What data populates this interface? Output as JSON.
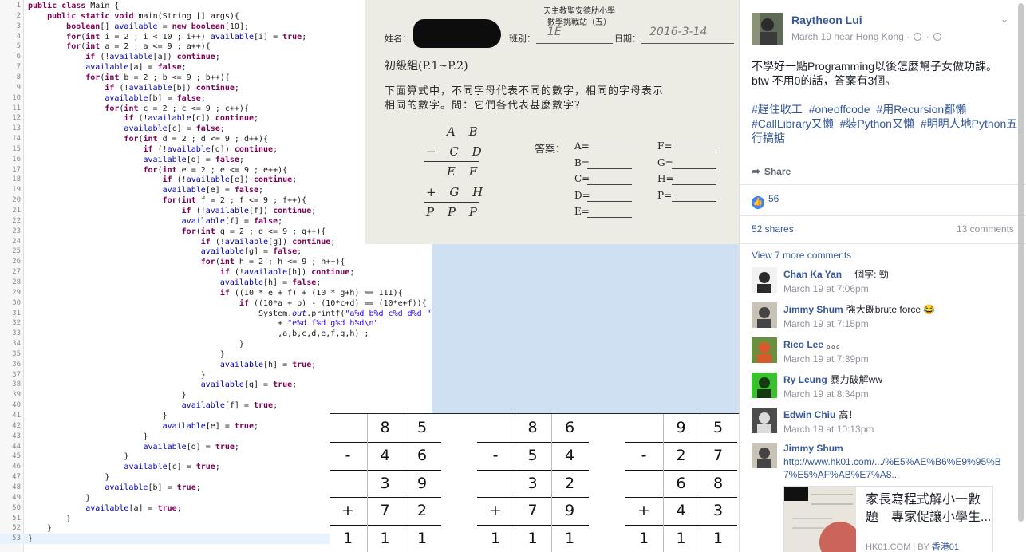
{
  "code": {
    "lines": [
      "public class Main {",
      "    public static void main(String [] args){",
      "        boolean[] available = new boolean[10];",
      "        for(int i = 2 ; i < 10 ; i++) available[i] = true;",
      "        for(int a = 2 ; a <= 9 ; a++){",
      "            if (!available[a]) continue;",
      "            available[a] = false;",
      "            for(int b = 2 ; b <= 9 ; b++){",
      "                if (!available[b]) continue;",
      "                available[b] = false;",
      "                for(int c = 2 ; c <= 9 ; c++){",
      "                    if (!available[c]) continue;",
      "                    available[c] = false;",
      "                    for(int d = 2 ; d <= 9 ; d++){",
      "                        if (!available[d]) continue;",
      "                        available[d] = false;",
      "                        for(int e = 2 ; e <= 9 ; e++){",
      "                            if (!available[e]) continue;",
      "                            available[e] = false;",
      "                            for(int f = 2 ; f <= 9 ; f++){",
      "                                if (!available[f]) continue;",
      "                                available[f] = false;",
      "                                for(int g = 2 ; g <= 9 ; g++){",
      "                                    if (!available[g]) continue;",
      "                                    available[g] = false;",
      "                                    for(int h = 2 ; h <= 9 ; h++){",
      "                                        if (!available[h]) continue;",
      "                                        available[h] = false;",
      "                                        if ((10 * e + f) + (10 * g+h) == 111){",
      "                                            if ((10*a + b) - (10*c+d) == (10*e+f)){",
      "                                                System.out.printf(\"a%d b%d c%d d%d \"",
      "                                                    + \"e%d f%d g%d h%d\\n\"",
      "                                                    ,a,b,c,d,e,f,g,h) ;",
      "                                            }",
      "                                        }",
      "                                        available[h] = true;",
      "                                    }",
      "                                    available[g] = true;",
      "                                }",
      "                                available[f] = true;",
      "                            }",
      "                            available[e] = true;",
      "                        }",
      "                        available[d] = true;",
      "                    }",
      "                    available[c] = true;",
      "                }",
      "                available[b] = true;",
      "            }",
      "            available[a] = true;",
      "        }",
      "    }",
      "}"
    ]
  },
  "sheet": {
    "school": "天主教聖安德肋小學",
    "title": "數學挑戰站（五）",
    "name_label": "姓名：",
    "class_label": "班別：",
    "class_value": "1E",
    "date_label": "日期：",
    "date_value": "2016-3-14",
    "level": "初級組(P.1~P.2)",
    "question_1": "下面算式中，不同字母代表不同的數字，相同的字母表示",
    "question_2": "相同的數字。問：它們各代表甚麼數字？",
    "puzzle": [
      "A B",
      "− C D",
      "E F",
      "+ G H",
      "P P P"
    ],
    "answer_label": "答案：",
    "answers_left": [
      "A=",
      "B=",
      "C=",
      "D=",
      "E="
    ],
    "answers_right": [
      "F=",
      "G=",
      "H=",
      "P="
    ]
  },
  "tables": [
    {
      "rows": [
        [
          "",
          "8",
          "5"
        ],
        [
          "-",
          "4",
          "6"
        ],
        [
          "",
          "3",
          "9"
        ],
        [
          "+",
          "7",
          "2"
        ],
        [
          "1",
          "1",
          "1"
        ]
      ]
    },
    {
      "rows": [
        [
          "",
          "8",
          "6"
        ],
        [
          "-",
          "5",
          "4"
        ],
        [
          "",
          "3",
          "2"
        ],
        [
          "+",
          "7",
          "9"
        ],
        [
          "1",
          "1",
          "1"
        ]
      ]
    },
    {
      "rows": [
        [
          "",
          "9",
          "5"
        ],
        [
          "-",
          "2",
          "7"
        ],
        [
          "",
          "6",
          "8"
        ],
        [
          "+",
          "4",
          "3"
        ],
        [
          "1",
          "1",
          "1"
        ]
      ]
    }
  ],
  "post": {
    "author": "Raytheon Lui",
    "meta": "March 19 near Hong Kong ·",
    "text_1": "不學好一點Programming以後怎麼幫子女做功課。",
    "text_2": "btw 不用0的話，答案有3個。",
    "tags": [
      "#趕住收工",
      "#oneoffcode",
      "#用Recursion都懶",
      "#CallLibrary又懶",
      "#裝Python又懶",
      "#明明人地Python五行搞掂"
    ],
    "share_label": "Share",
    "likes": "56",
    "shares": "52 shares",
    "comments_count": "13 comments",
    "view_more": "View 7 more comments"
  },
  "comments": [
    {
      "name": "Chan Ka Yan",
      "text": "一個字: 勁",
      "time": "March 19 at 7:06pm"
    },
    {
      "name": "Jimmy Shum",
      "text": "強大既brute force 😂",
      "time": "March 19 at 7:15pm"
    },
    {
      "name": "Rico Lee",
      "text": "。。。",
      "time": "March 19 at 7:39pm"
    },
    {
      "name": "Ry Leung",
      "text": "暴力破解ww",
      "time": "March 19 at 8:34pm"
    },
    {
      "name": "Edwin Chiu",
      "text": "高！",
      "time": "March 19 at 10:13pm"
    },
    {
      "name": "Jimmy Shum",
      "text": "",
      "link": "http://www.hk01.com/.../%E5%AE%B6%E9%95%B7%E5%AF%AB%E7%A8..."
    }
  ],
  "preview": {
    "title": "家長寫程式解小一數題　專家促讓小學生...",
    "source": "HK01.COM | BY",
    "source_link": "香港01"
  },
  "colors": {
    "link": "#365899",
    "meta": "#90949c",
    "like": "#4080ff",
    "keyword": "#7f0055",
    "string": "#2a00ff"
  }
}
